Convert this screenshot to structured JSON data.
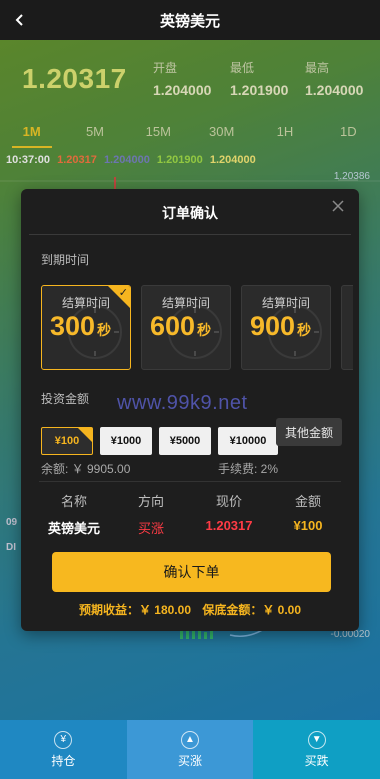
{
  "nav": {
    "title": "英镑美元",
    "back_icon": "chevron-left-icon"
  },
  "quote": {
    "price": "1.20317",
    "open_label": "开盘",
    "open": "1.204000",
    "low_label": "最低",
    "low": "1.201900",
    "high_label": "最高",
    "high": "1.204000"
  },
  "tabs": [
    "1M",
    "5M",
    "15M",
    "30M",
    "1H",
    "1D"
  ],
  "active_tab": "1M",
  "ohlc_line": {
    "time": "10:37:00",
    "v1": "1.20317",
    "v2": "1.204000",
    "v3": "1.201900",
    "v4": "1.204000"
  },
  "chart": {
    "axis_top": "1.20386",
    "axis_bottom": "-0.00020",
    "left_label_1": "09",
    "left_label_2": "DI"
  },
  "modal": {
    "title": "订单确认",
    "expiry_label": "到期时间",
    "time_cards": [
      {
        "label": "结算时间",
        "value": "300",
        "unit": "秒",
        "selected": true
      },
      {
        "label": "结算时间",
        "value": "600",
        "unit": "秒",
        "selected": false
      },
      {
        "label": "结算时间",
        "value": "900",
        "unit": "秒",
        "selected": false
      }
    ],
    "amount_label": "投资金额",
    "amounts": [
      "¥100",
      "¥1000",
      "¥5000",
      "¥10000"
    ],
    "selected_amount": "¥100",
    "other_amount_label": "其他金额",
    "balance": "余额: ￥ 9905.00",
    "fee": "手续费: 2%",
    "summary_headers": [
      "名称",
      "方向",
      "现价",
      "金额"
    ],
    "summary_values": {
      "name": "英镑美元",
      "direction": "买涨",
      "price": "1.20317",
      "amount": "¥100"
    },
    "confirm_label": "确认下单",
    "expected_profit": "预期收益：￥ 180.00",
    "guaranteed_amount": "保底金额：￥ 0.00"
  },
  "watermark": "www.99k9.net",
  "bottom_bar": [
    {
      "label": "持仓",
      "icon": "coins-icon"
    },
    {
      "label": "买涨",
      "icon": "up-icon"
    },
    {
      "label": "买跌",
      "icon": "down-icon"
    }
  ],
  "colors": {
    "accent": "#f6b51f",
    "up": "#ff3b45",
    "price_green": "#e9ee7a"
  }
}
